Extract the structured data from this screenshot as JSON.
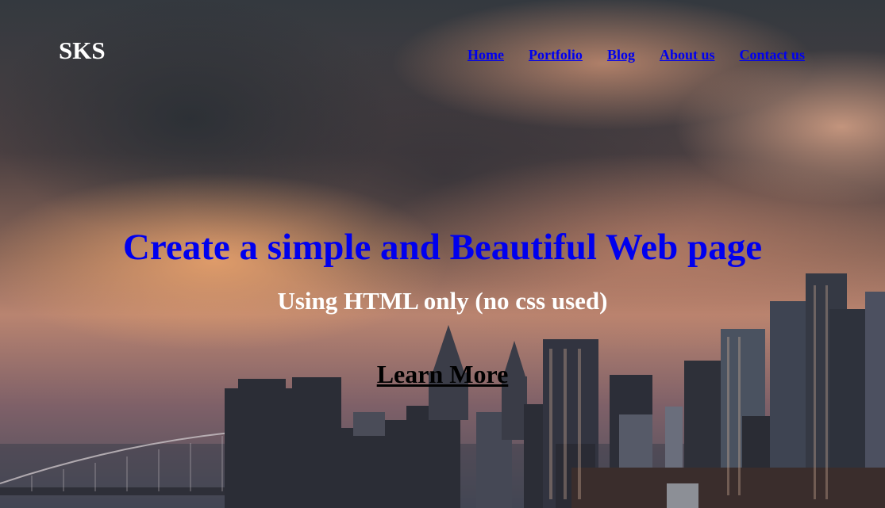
{
  "header": {
    "logo": "SKS",
    "nav": [
      {
        "label": "Home"
      },
      {
        "label": "Portfolio"
      },
      {
        "label": "Blog"
      },
      {
        "label": "About us"
      },
      {
        "label": "Contact us"
      }
    ]
  },
  "hero": {
    "headline": "Create a simple and Beautiful Web page",
    "subheadline": "Using HTML only (no css used)",
    "cta_label": "Learn More",
    "background": "sunset-city-skyline-photo"
  },
  "colors": {
    "link": "#0000ee",
    "headline": "#0000ee",
    "logo": "#ffffff",
    "subheadline": "#ffffff",
    "cta": "#000000"
  }
}
